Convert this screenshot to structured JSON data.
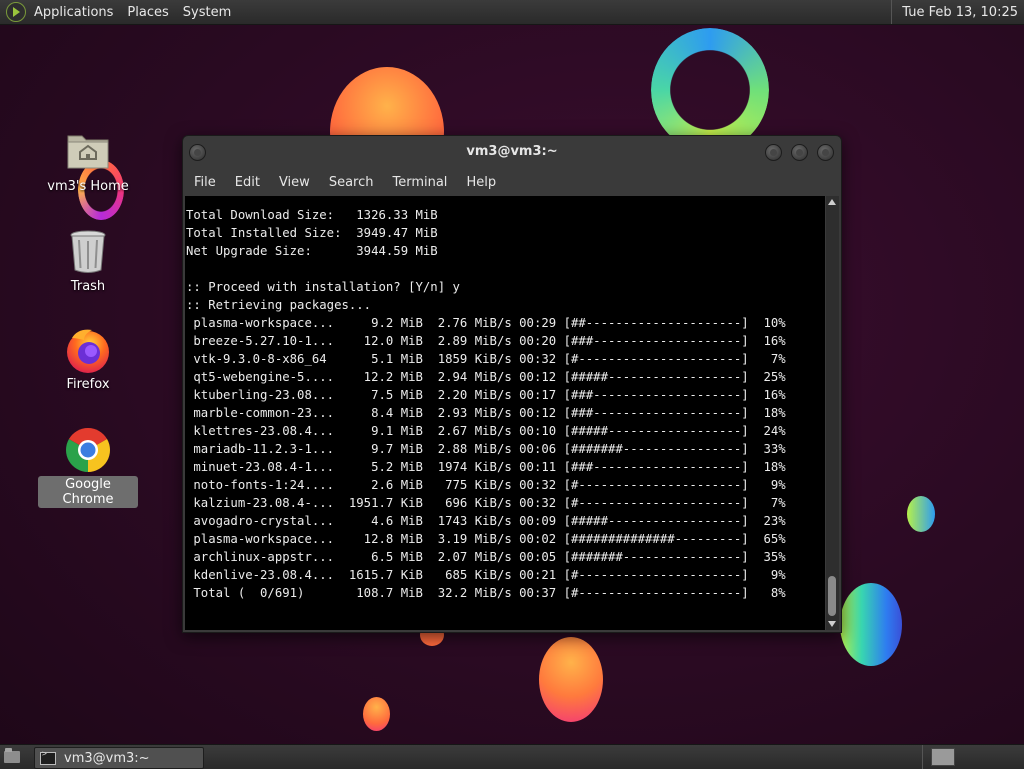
{
  "top_panel": {
    "menus": [
      "Applications",
      "Places",
      "System"
    ],
    "clock": "Tue Feb 13, 10:25"
  },
  "desktop": {
    "icons": [
      {
        "label": "vm3's Home",
        "icon": "home-folder-icon"
      },
      {
        "label": "Trash",
        "icon": "trash-icon"
      },
      {
        "label": "Firefox",
        "icon": "firefox-icon"
      },
      {
        "label": "Google Chrome",
        "icon": "chrome-icon"
      }
    ]
  },
  "terminal": {
    "title": "vm3@vm3:~",
    "menus": [
      "File",
      "Edit",
      "View",
      "Search",
      "Terminal",
      "Help"
    ],
    "lines": [
      "Total Download Size:   1326.33 MiB",
      "Total Installed Size:  3949.47 MiB",
      "Net Upgrade Size:      3944.59 MiB",
      "",
      ":: Proceed with installation? [Y/n] y",
      ":: Retrieving packages...",
      " plasma-workspace...     9.2 MiB  2.76 MiB/s 00:29 [##---------------------]  10%",
      " breeze-5.27.10-1...    12.0 MiB  2.89 MiB/s 00:20 [###--------------------]  16%",
      " vtk-9.3.0-8-x86_64      5.1 MiB  1859 KiB/s 00:32 [#----------------------]   7%",
      " qt5-webengine-5....    12.2 MiB  2.94 MiB/s 00:12 [#####------------------]  25%",
      " ktuberling-23.08...     7.5 MiB  2.20 MiB/s 00:17 [###--------------------]  16%",
      " marble-common-23...     8.4 MiB  2.93 MiB/s 00:12 [###--------------------]  18%",
      " klettres-23.08.4...     9.1 MiB  2.67 MiB/s 00:10 [#####------------------]  24%",
      " mariadb-11.2.3-1...     9.7 MiB  2.88 MiB/s 00:06 [#######----------------]  33%",
      " minuet-23.08.4-1...     5.2 MiB  1974 KiB/s 00:11 [###--------------------]  18%",
      " noto-fonts-1:24....     2.6 MiB   775 KiB/s 00:32 [#----------------------]   9%",
      " kalzium-23.08.4-...  1951.7 KiB   696 KiB/s 00:32 [#----------------------]   7%",
      " avogadro-crystal...     4.6 MiB  1743 KiB/s 00:09 [#####------------------]  23%",
      " plasma-workspace...    12.8 MiB  3.19 MiB/s 00:02 [##############---------]  65%",
      " archlinux-appstr...     6.5 MiB  2.07 MiB/s 00:05 [#######----------------]  35%",
      " kdenlive-23.08.4...  1615.7 KiB   685 KiB/s 00:21 [#----------------------]   9%",
      " Total (  0/691)       108.7 MiB  32.2 MiB/s 00:37 [#----------------------]   8%"
    ]
  },
  "taskbar": {
    "tasks": [
      {
        "label": "vm3@vm3:~",
        "icon": "terminal-icon"
      }
    ]
  }
}
